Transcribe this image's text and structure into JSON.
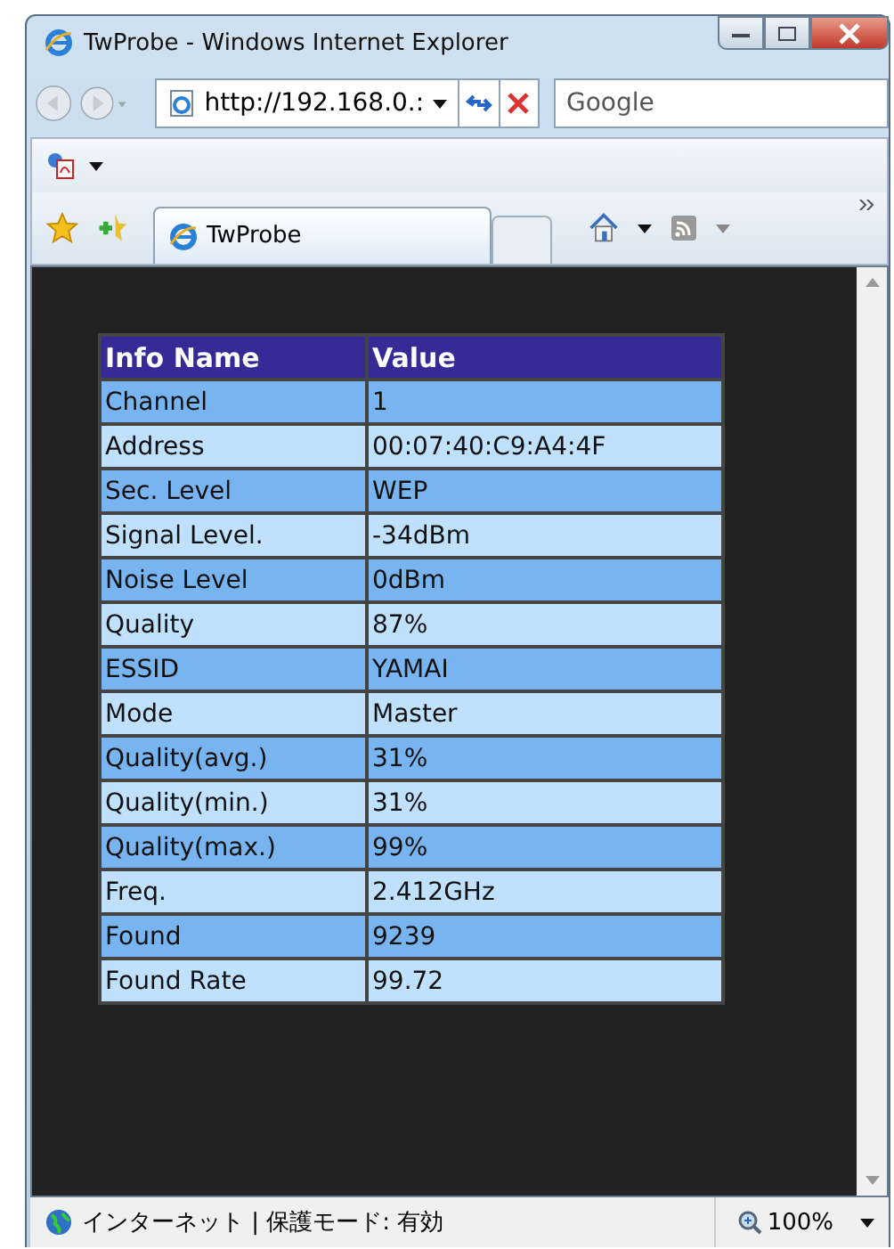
{
  "window": {
    "title": "TwProbe - Windows Internet Explorer"
  },
  "address_bar": {
    "value": "http://192.168.0.:"
  },
  "search": {
    "placeholder": "Google"
  },
  "tabs": [
    {
      "label": "TwProbe",
      "selected": true
    }
  ],
  "table": {
    "columns": [
      "Info Name",
      "Value"
    ],
    "rows": [
      [
        "Channel",
        "1"
      ],
      [
        "Address",
        "00:07:40:C9:A4:4F"
      ],
      [
        "Sec. Level",
        "WEP"
      ],
      [
        "Signal Level.",
        "-34dBm"
      ],
      [
        "Noise Level",
        "0dBm"
      ],
      [
        "Quality",
        "87%"
      ],
      [
        "ESSID",
        "YAMAI"
      ],
      [
        "Mode",
        "Master"
      ],
      [
        "Quality(avg.)",
        "31%"
      ],
      [
        "Quality(min.)",
        "31%"
      ],
      [
        "Quality(max.)",
        "99%"
      ],
      [
        "Freq.",
        "2.412GHz"
      ],
      [
        "Found",
        "9239"
      ],
      [
        "Found Rate",
        "99.72"
      ]
    ]
  },
  "status_bar": {
    "zone": "インターネット | 保護モード: 有効",
    "zoom": "100%"
  }
}
